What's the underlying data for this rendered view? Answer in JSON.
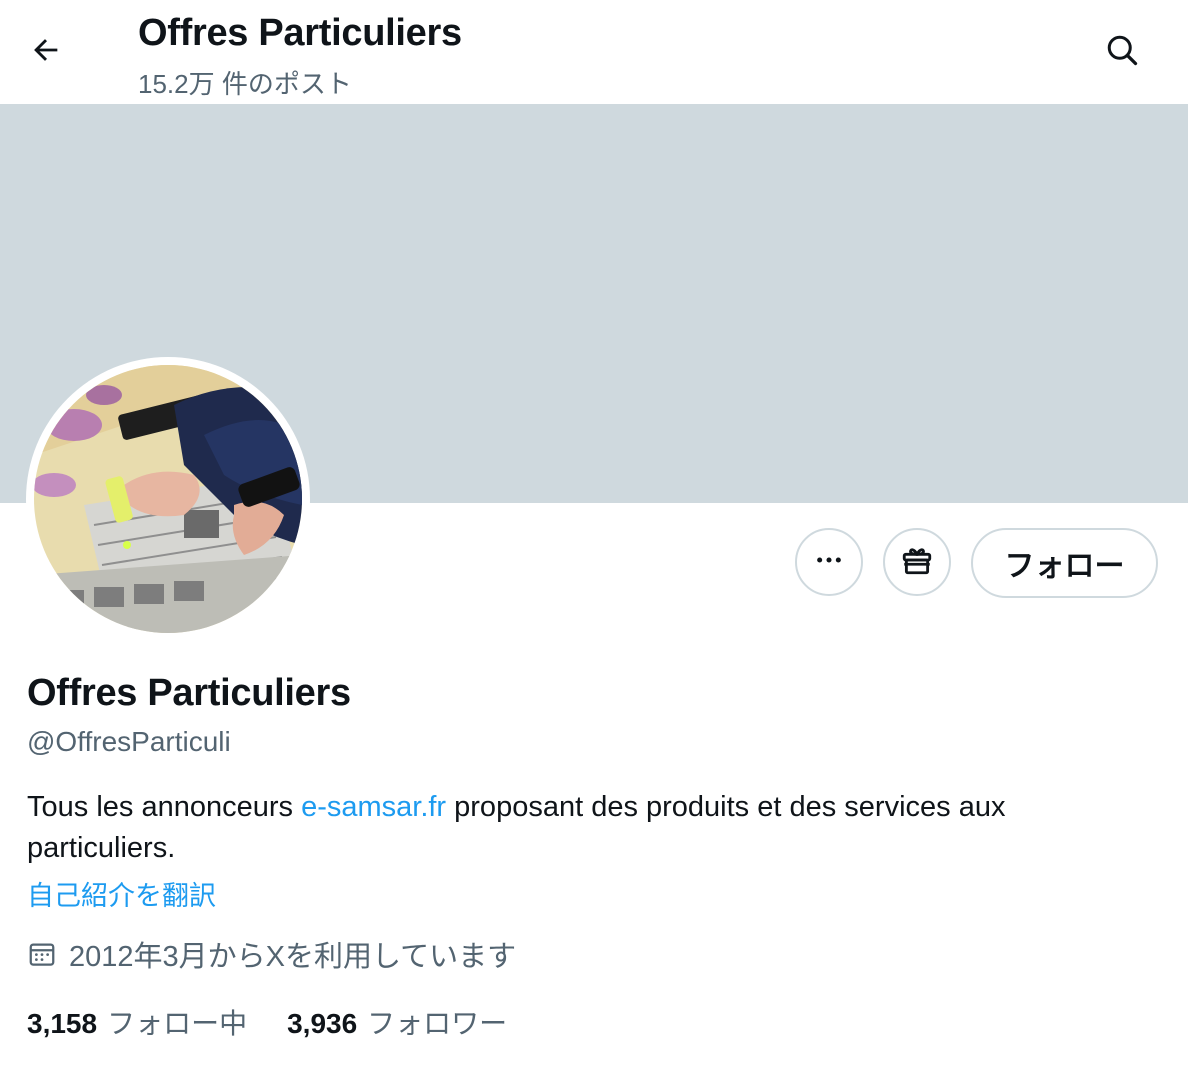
{
  "header": {
    "title": "Offres Particuliers",
    "post_count": "15.2万 件のポスト",
    "back_icon": "arrow-left-icon",
    "search_icon": "search-icon"
  },
  "banner": {
    "color": "#cfd9de"
  },
  "actions": {
    "more_icon": "more-horizontal-icon",
    "gift_icon": "gift-icon",
    "follow_label": "フォロー"
  },
  "profile": {
    "name": "Offres Particuliers",
    "handle": "@OffresParticuli",
    "bio_before": "Tous les annonceurs ",
    "bio_link": "e-samsar.fr",
    "bio_after": " proposant des produits et des services aux particuliers.",
    "translate_label": "自己紹介を翻訳",
    "joined": "2012年3月からXを利用しています",
    "calendar_icon": "calendar-icon"
  },
  "stats": {
    "following_count": "3,158",
    "following_label": "フォロー中",
    "followers_count": "3,936",
    "followers_label": "フォロワー"
  },
  "colors": {
    "accent_link": "#1d9bf0",
    "secondary_text": "#536471",
    "border": "#cfd9de",
    "primary_text": "#0f1419"
  }
}
